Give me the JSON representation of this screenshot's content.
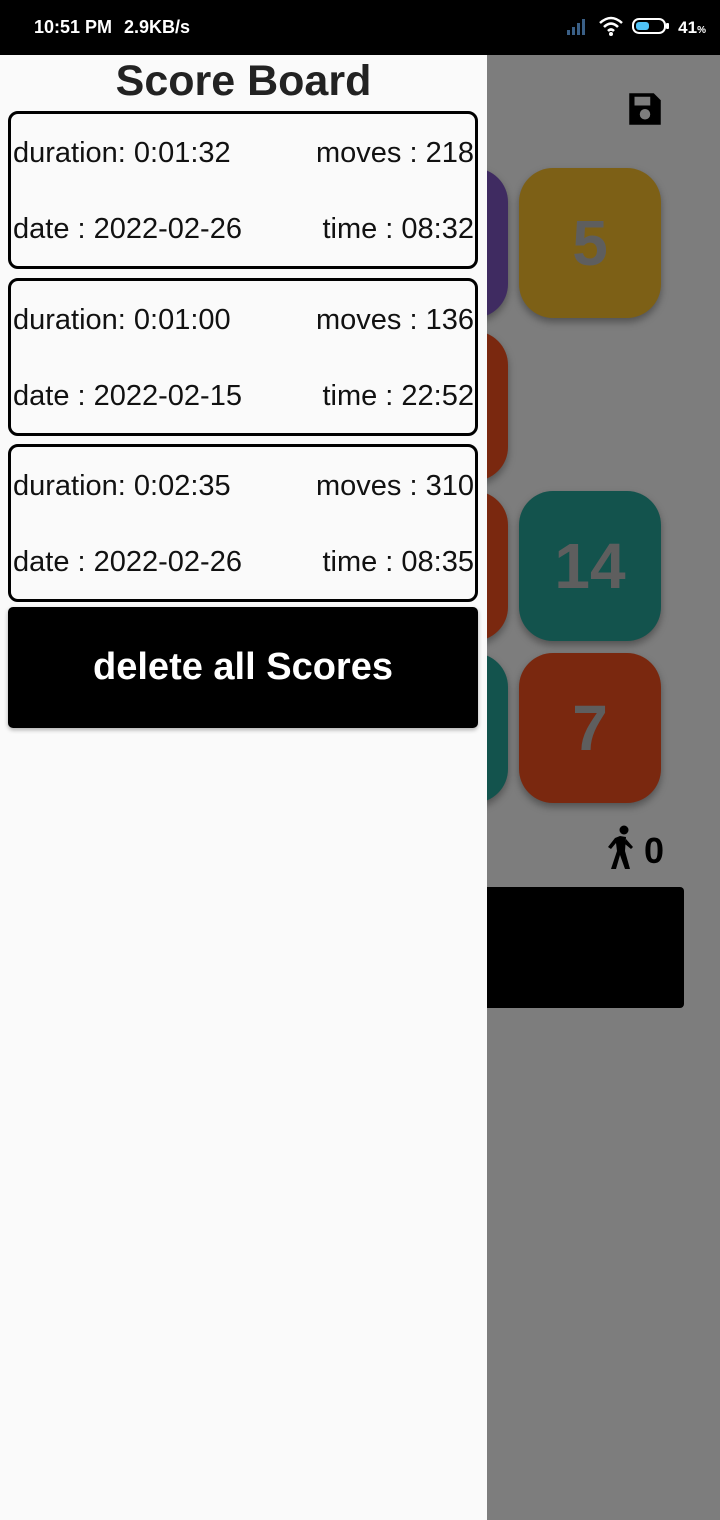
{
  "status_bar": {
    "time": "10:51 PM",
    "network_speed": "2.9KB/s",
    "battery_percent": "41",
    "battery_unit": "%",
    "icons": [
      "signal-icon",
      "wifi-icon",
      "battery-icon"
    ]
  },
  "drawer": {
    "title": "Score Board",
    "scores": [
      {
        "duration": "duration: 0:01:32",
        "moves": "moves : 218",
        "date": "date : 2022-02-26",
        "time": "time : 08:32"
      },
      {
        "duration": "duration: 0:01:00",
        "moves": "moves : 136",
        "date": "date : 2022-02-15",
        "time": "time : 22:52"
      },
      {
        "duration": "duration: 0:02:35",
        "moves": "moves : 310",
        "date": "date : 2022-02-26",
        "time": "time : 08:35"
      }
    ],
    "delete_label": "delete all Scores"
  },
  "game": {
    "tiles": [
      {
        "label": "5",
        "color": "#fbc02d"
      },
      {
        "label": "14",
        "color": "#26a69a"
      },
      {
        "label": "7",
        "color": "#f4511e"
      },
      {
        "label": "",
        "color": "#7e57c2"
      },
      {
        "label": "",
        "color": "#f4511e"
      },
      {
        "label": "",
        "color": "#f4511e"
      },
      {
        "label": "",
        "color": "#26a69a"
      }
    ],
    "moves_count": "0",
    "icons": [
      "save-icon",
      "walking-person-icon"
    ]
  },
  "colors": {
    "scrim": "rgba(0,0,0,0.5)",
    "drawer_bg": "#fafafa",
    "button_bg": "#000000"
  }
}
